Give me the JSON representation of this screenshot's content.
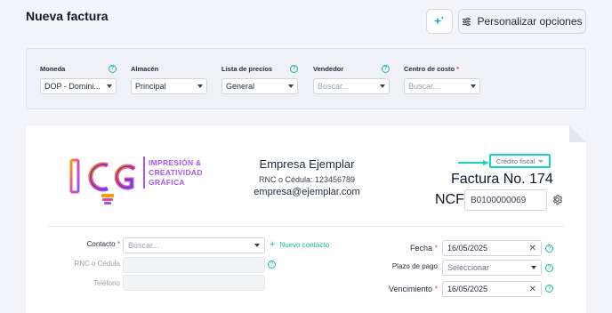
{
  "header": {
    "title": "Nueva factura",
    "customize_label": "Personalizar opciones"
  },
  "filters": {
    "currency": {
      "label": "Moneda",
      "value": "DOP - Domini..."
    },
    "warehouse": {
      "label": "Almacén",
      "value": "Principal"
    },
    "price_list": {
      "label": "Lista de precios",
      "value": "General"
    },
    "seller": {
      "label": "Vendedor",
      "placeholder": "Buscar..."
    },
    "cost_center": {
      "label": "Centro de costo",
      "required": "*",
      "placeholder": "Buscar..."
    }
  },
  "company": {
    "logo_lines": [
      "IMPRESIÓN &",
      "CREATIVIDAD",
      "GRÁFICA"
    ],
    "logo_letters": "ICG",
    "name": "Empresa Ejemplar",
    "rnc": "RNC o Cédula: 123456789",
    "email": "empresa@ejemplar.com"
  },
  "invoice": {
    "type": "Crédito fiscal",
    "number_label": "Factura No. 174",
    "ncf_label": "NCF",
    "ncf_value": "B0100000069"
  },
  "client": {
    "contact_label": "Contacto",
    "contact_required": "*",
    "contact_placeholder": "Buscar...",
    "new_contact_label": "Nuevo contacto",
    "rnc_label": "RNC o Cédula",
    "phone_label": "Teléfono"
  },
  "dates": {
    "date_label": "Fecha",
    "date_required": "*",
    "date_value": "16/05/2025",
    "term_label": "Plazo de pago",
    "term_placeholder": "Seleccionar",
    "due_label": "Vencimiento",
    "due_required": "*",
    "due_value": "16/05/2025"
  },
  "colors": {
    "accent": "#14b8a6",
    "highlight": "#14d5c4",
    "required": "#ef4444",
    "logo": "#a855f7"
  }
}
